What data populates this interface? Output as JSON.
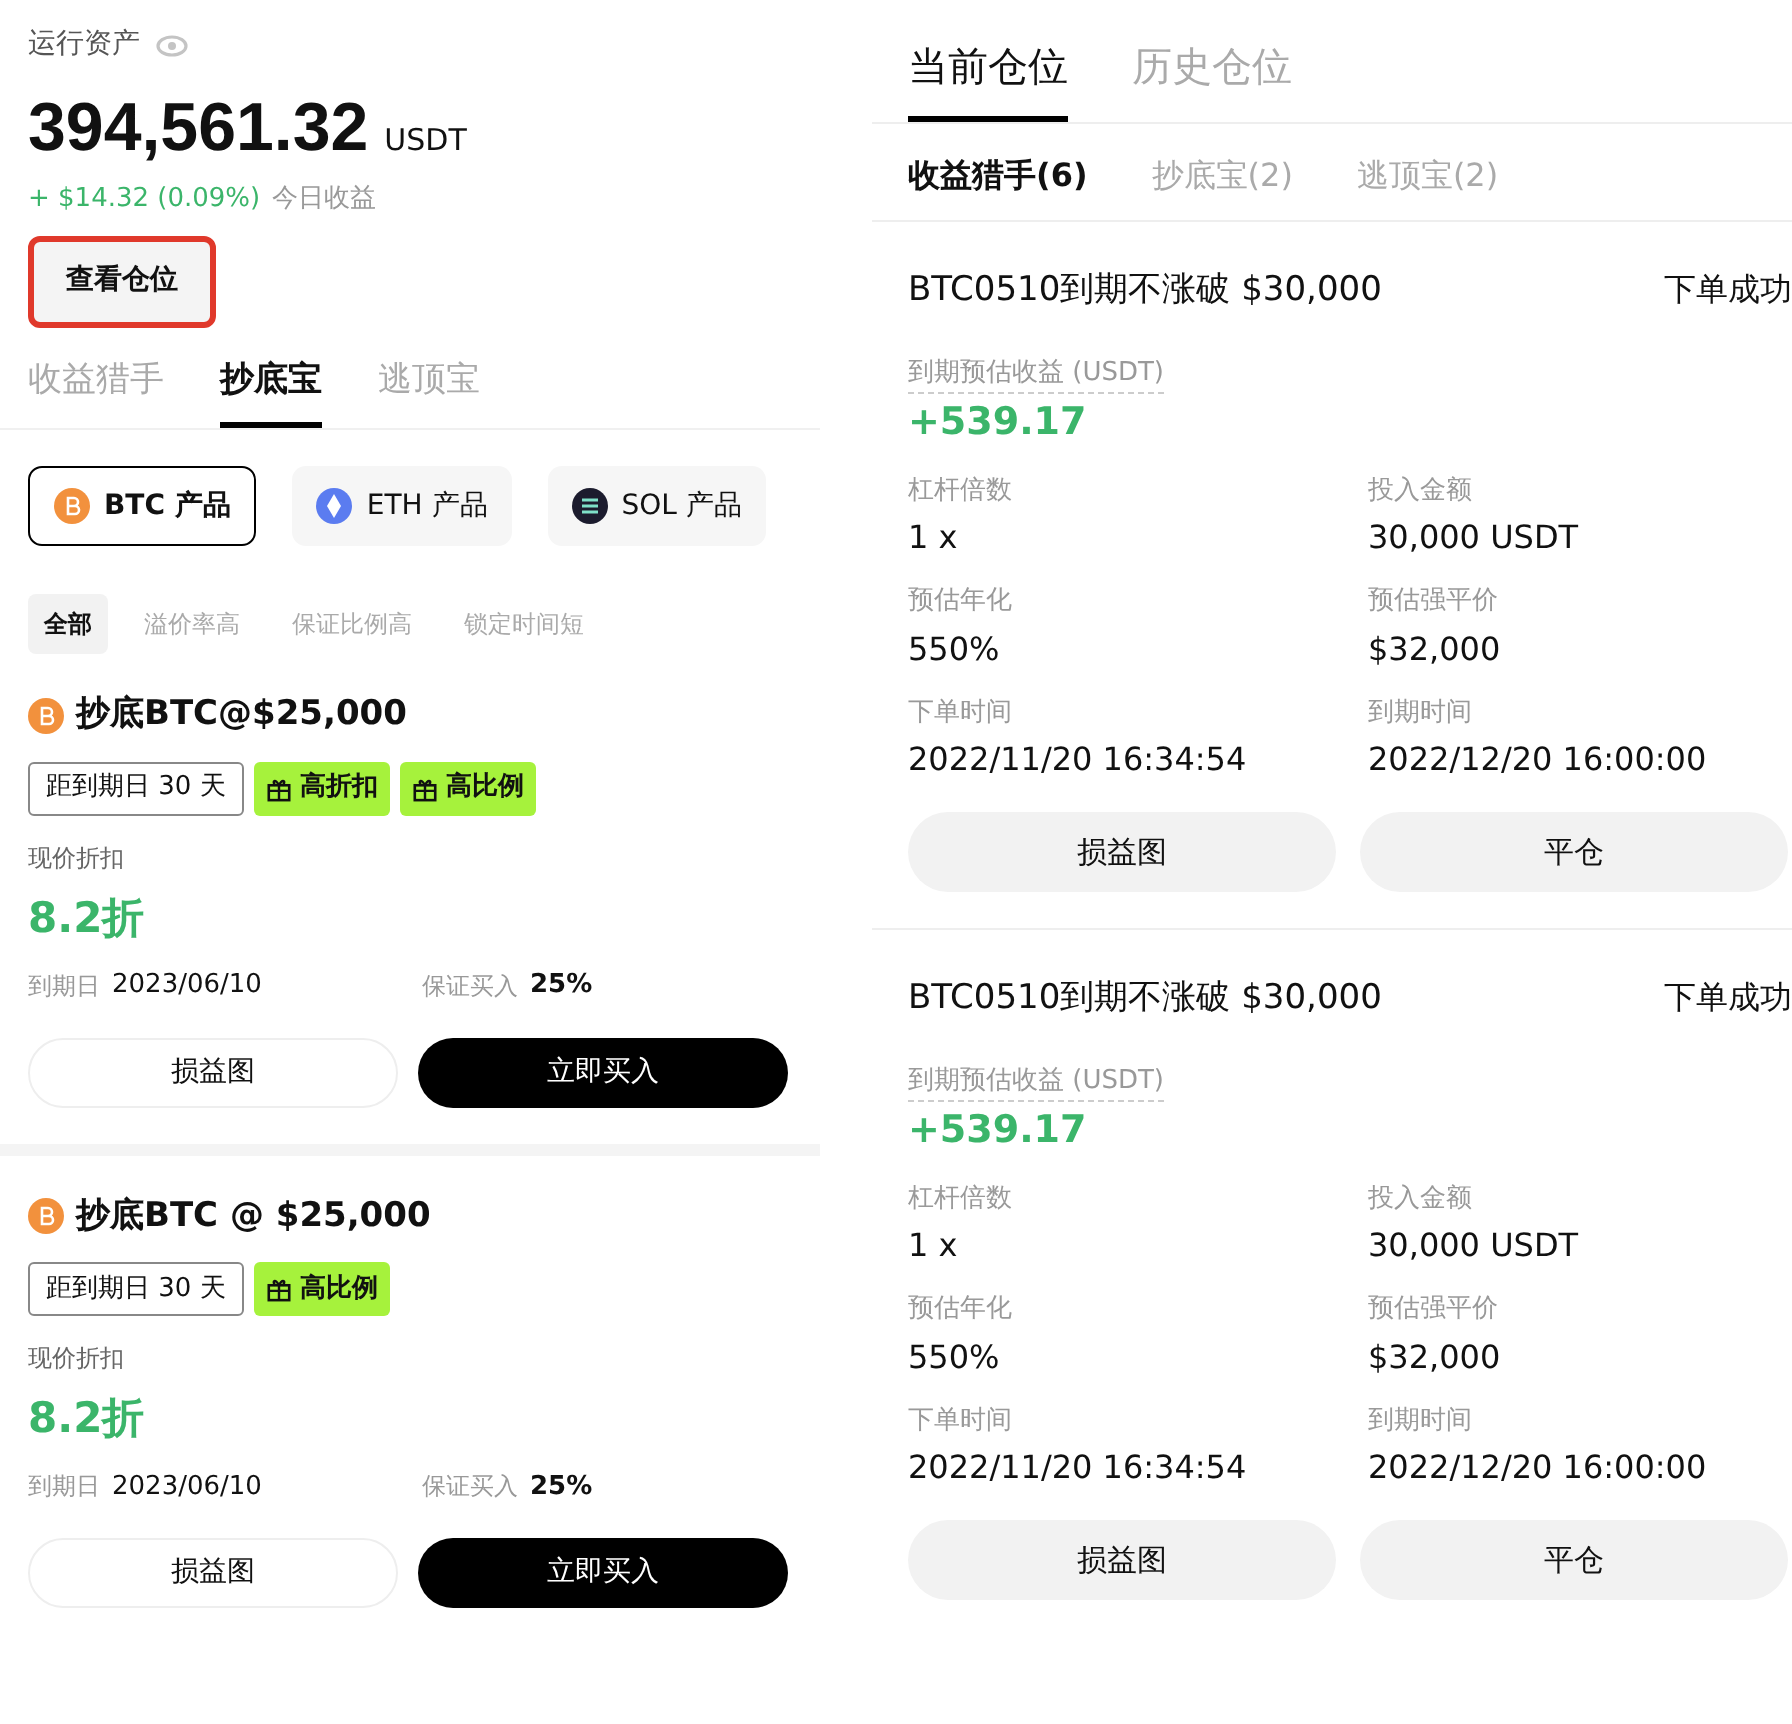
{
  "assets": {
    "label": "运行资产",
    "amount": "394,561.32",
    "unit": "USDT",
    "change": "+ $14.32 (0.09%)",
    "change_label": "今日收益",
    "view_button": {
      "label": "查看仓位",
      "highlighted": true
    }
  },
  "product_tabs": [
    {
      "label": "收益猎手",
      "selected": false
    },
    {
      "label": "抄底宝",
      "selected": true
    },
    {
      "label": "逃顶宝",
      "selected": false
    }
  ],
  "coins": [
    {
      "label": "BTC 产品",
      "color": "#f2913d",
      "selected": true
    },
    {
      "label": "ETH 产品",
      "color": "#5b7cf0",
      "selected": false
    },
    {
      "label": "SOL 产品",
      "color": "#1c1c2e",
      "selected": false
    }
  ],
  "filters": [
    {
      "label": "全部",
      "selected": true
    },
    {
      "label": "溢价率高",
      "selected": false
    },
    {
      "label": "保证比例高",
      "selected": false
    },
    {
      "label": "锁定时间短",
      "selected": false
    }
  ],
  "products": [
    {
      "title": "抄底BTC@$25,000",
      "tags": [
        {
          "kind": "outline",
          "label": "距到期日 30 天"
        },
        {
          "kind": "gift",
          "label": "高折扣"
        },
        {
          "kind": "gift",
          "label": "高比例"
        }
      ],
      "discount_label": "现价折扣",
      "discount": "8.2折",
      "expiry_label": "到期日",
      "expiry": "2023/06/10",
      "guarantee_label": "保证买入",
      "guarantee": "25%",
      "buttons": [
        "损益图",
        "立即买入"
      ]
    },
    {
      "title": "抄底BTC @ $25,000",
      "tags": [
        {
          "kind": "outline",
          "label": "距到期日 30 天"
        },
        {
          "kind": "gift",
          "label": "高比例"
        }
      ],
      "discount_label": "现价折扣",
      "discount": "8.2折",
      "expiry_label": "到期日",
      "expiry": "2023/06/10",
      "guarantee_label": "保证买入",
      "guarantee": "25%",
      "buttons": [
        "损益图",
        "立即买入"
      ]
    }
  ],
  "position_tabs": [
    {
      "label": "当前仓位",
      "selected": true
    },
    {
      "label": "历史仓位",
      "selected": false
    }
  ],
  "position_subtabs": [
    {
      "label": "收益猎手(6)",
      "selected": true
    },
    {
      "label": "抄底宝(2)",
      "selected": false
    },
    {
      "label": "逃顶宝(2)",
      "selected": false
    }
  ],
  "positions": [
    {
      "title": "BTC0510到期不涨破 $30,000",
      "status": "下单成功",
      "profit_label": "到期预估收益 (USDT)",
      "profit": "+539.17",
      "fields": [
        {
          "label": "杠杆倍数",
          "value": "1 x"
        },
        {
          "label": "投入金额",
          "value": "30,000 USDT"
        },
        {
          "label": "预估年化",
          "value": "550%"
        },
        {
          "label": "预估强平价",
          "value": "$32,000"
        },
        {
          "label": "下单时间",
          "value": "2022/11/20 16:34:54"
        },
        {
          "label": "到期时间",
          "value": "2022/12/20 16:00:00"
        }
      ],
      "buttons": [
        "损益图",
        "平仓"
      ]
    },
    {
      "title": "BTC0510到期不涨破 $30,000",
      "status": "下单成功",
      "profit_label": "到期预估收益 (USDT)",
      "profit": "+539.17",
      "fields": [
        {
          "label": "杠杆倍数",
          "value": "1 x"
        },
        {
          "label": "投入金额",
          "value": "30,000 USDT"
        },
        {
          "label": "预估年化",
          "value": "550%"
        },
        {
          "label": "预估强平价",
          "value": "$32,000"
        },
        {
          "label": "下单时间",
          "value": "2022/11/20 16:34:54"
        },
        {
          "label": "到期时间",
          "value": "2022/12/20 16:00:00"
        }
      ],
      "buttons": [
        "损益图",
        "平仓"
      ]
    }
  ]
}
